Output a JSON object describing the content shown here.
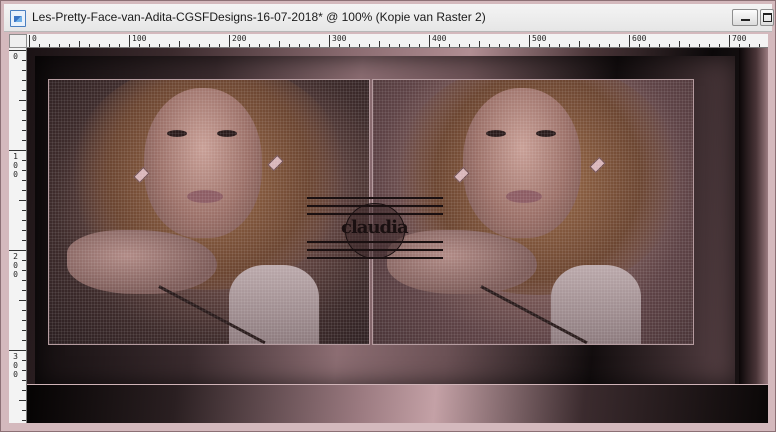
{
  "window": {
    "title": "Les-Pretty-Face-van-Adita-CGSFDesigns-16-07-2018* @ 100% (Kopie van Raster 2)",
    "app_icon": "image-document-icon",
    "controls": [
      "minimize-icon",
      "maximize-icon"
    ]
  },
  "ruler": {
    "horizontal_labels": [
      "0",
      "100",
      "200",
      "300",
      "400",
      "500",
      "600",
      "700"
    ],
    "vertical_labels": [
      [
        "0"
      ],
      [
        "1",
        "0",
        "0"
      ],
      [
        "2",
        "0",
        "0"
      ],
      [
        "3",
        "0",
        "0"
      ]
    ]
  },
  "canvas": {
    "watermark_text": "claudia"
  },
  "colors": {
    "frame_dark": "#1a1214",
    "frame_rose": "#b18e93",
    "window_bg": "#d4b9bd"
  }
}
